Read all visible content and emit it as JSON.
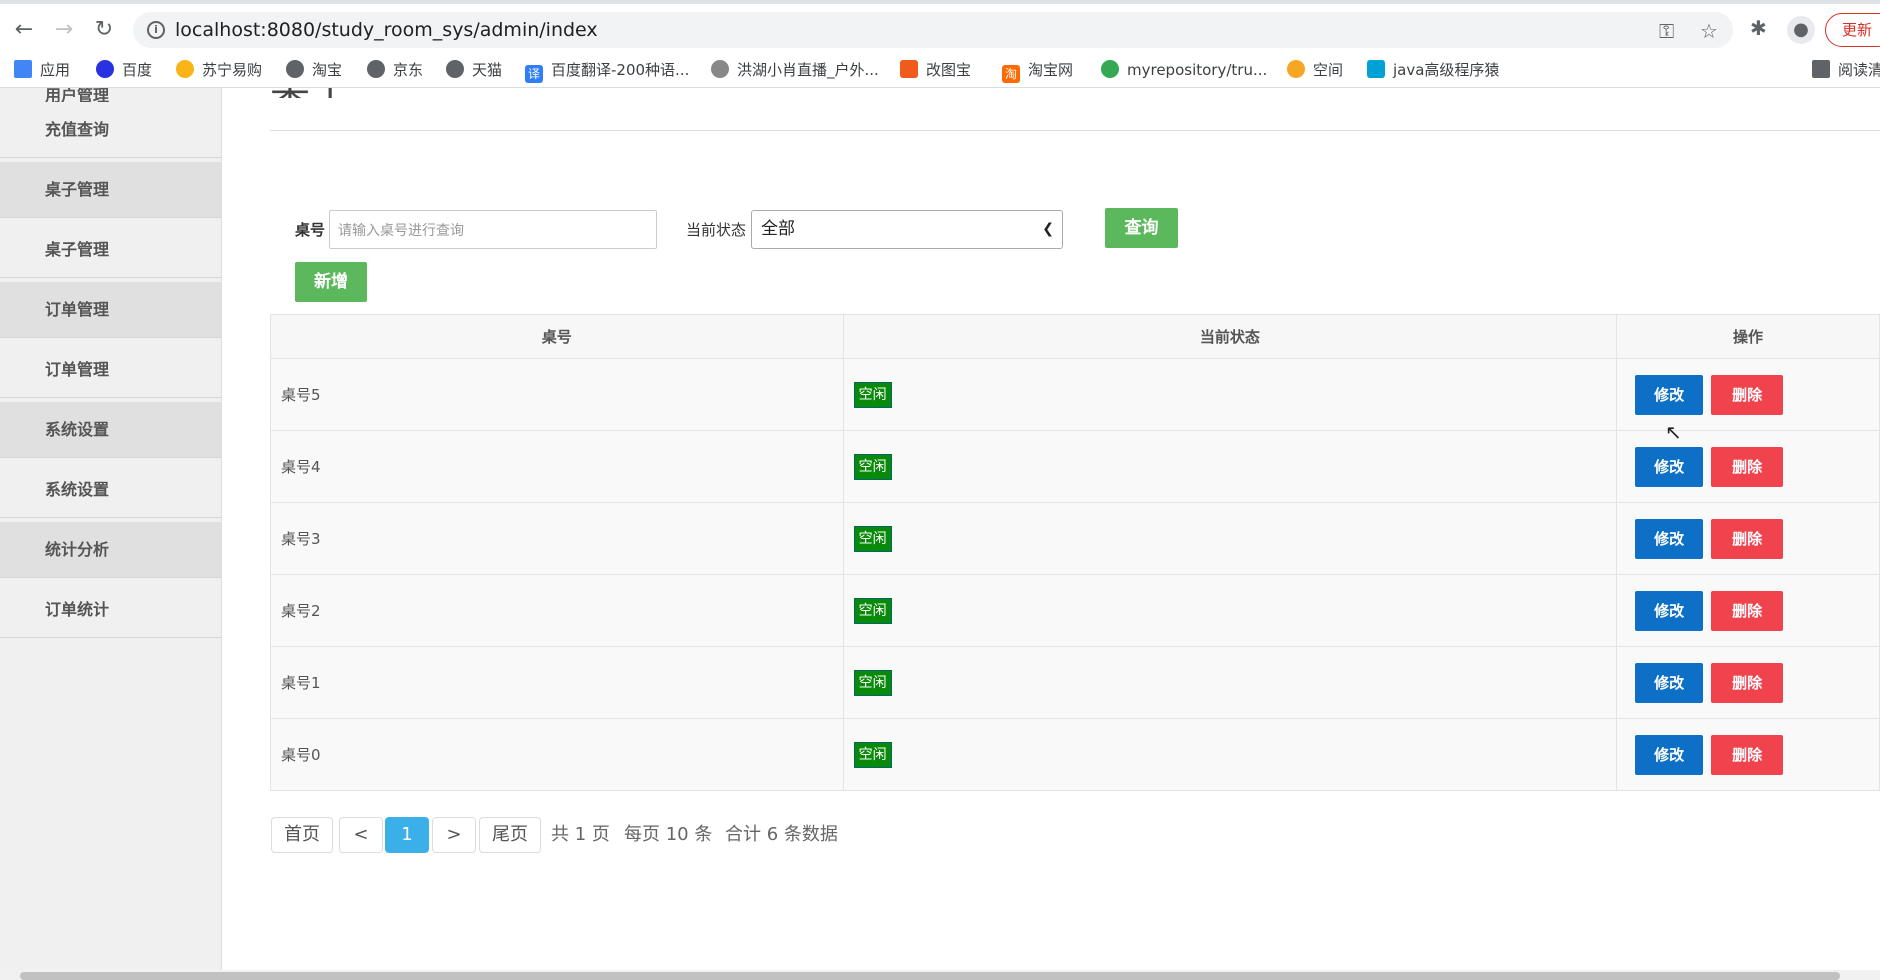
{
  "browser": {
    "url": "localhost:8080/study_room_sys/admin/index",
    "update_label": "更新"
  },
  "bookmarks": [
    {
      "label": "应用",
      "icon": "apps-grid-icon"
    },
    {
      "label": "百度",
      "icon": "baidu-icon"
    },
    {
      "label": "苏宁易购",
      "icon": "suning-icon"
    },
    {
      "label": "淘宝",
      "icon": "globe-icon"
    },
    {
      "label": "京东",
      "icon": "globe-icon"
    },
    {
      "label": "天猫",
      "icon": "globe-icon"
    },
    {
      "label": "百度翻译-200种语...",
      "icon": "translate-icon"
    },
    {
      "label": "洪湖小肖直播_户外...",
      "icon": "bird-icon"
    },
    {
      "label": "改图宝",
      "icon": "gaitubao-icon"
    },
    {
      "label": "淘宝网",
      "icon": "taobao-icon"
    },
    {
      "label": "myrepository/tru...",
      "icon": "chrome-icon"
    },
    {
      "label": "空间",
      "icon": "qzone-icon"
    },
    {
      "label": "java高级程序猿",
      "icon": "bilibili-icon"
    },
    {
      "label": "阅读清",
      "icon": "reading-list-icon"
    }
  ],
  "sidebar": {
    "top_fragment": "用户管理",
    "items": [
      {
        "label": "充值查询",
        "group": false
      },
      {
        "label": "桌子管理",
        "group": true
      },
      {
        "label": "桌子管理",
        "group": false
      },
      {
        "label": "订单管理",
        "group": true
      },
      {
        "label": "订单管理",
        "group": false
      },
      {
        "label": "系统设置",
        "group": true
      },
      {
        "label": "系统设置",
        "group": false
      },
      {
        "label": "统计分析",
        "group": true
      },
      {
        "label": "订单统计",
        "group": false
      }
    ]
  },
  "main": {
    "title_fragment": "桌子",
    "search": {
      "table_label": "桌号",
      "table_placeholder": "请输入桌号进行查询",
      "status_label": "当前状态",
      "status_value": "全部",
      "query_button": "查询",
      "add_button": "新增"
    },
    "table": {
      "headers": [
        "桌号",
        "当前状态",
        "操作"
      ],
      "rows": [
        {
          "number": "桌号5",
          "status": "空闲"
        },
        {
          "number": "桌号4",
          "status": "空闲"
        },
        {
          "number": "桌号3",
          "status": "空闲"
        },
        {
          "number": "桌号2",
          "status": "空闲"
        },
        {
          "number": "桌号1",
          "status": "空闲"
        },
        {
          "number": "桌号0",
          "status": "空闲"
        }
      ],
      "edit_label": "修改",
      "delete_label": "删除"
    },
    "pager": {
      "first": "首页",
      "prev": "<",
      "current": "1",
      "next": ">",
      "last": "尾页",
      "total_pages": "共 1 页",
      "per_page": "每页 10 条",
      "total_records": "合计 6 条数据"
    }
  },
  "colors": {
    "green": "#5cb85c",
    "edit_blue": "#0d6fc5",
    "delete_red": "#f0434e",
    "badge_green": "#0a8a0a",
    "pager_active": "#3bb0e8"
  }
}
